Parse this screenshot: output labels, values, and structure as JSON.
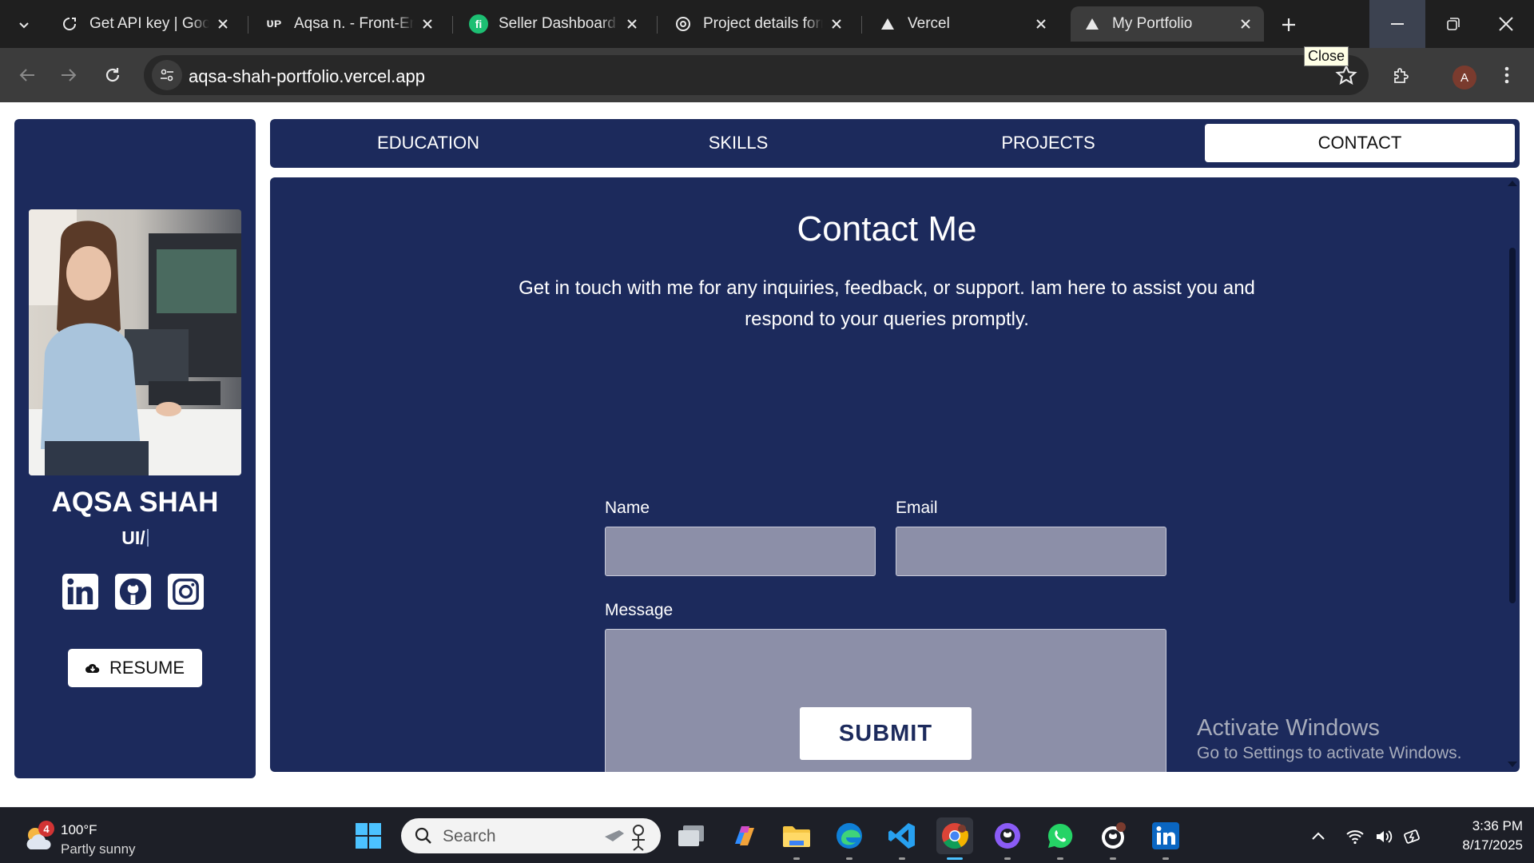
{
  "browser": {
    "tabs": [
      {
        "title": "Get API key | Google AI Studio",
        "icon": "ai-studio-icon"
      },
      {
        "title": "Aqsa n. - Front-End Developer",
        "icon": "upwork-icon"
      },
      {
        "title": "Seller Dashboard",
        "icon": "fiverr-icon"
      },
      {
        "title": "Project details form",
        "icon": "chatgpt-icon"
      },
      {
        "title": "Vercel",
        "icon": "vercel-icon"
      },
      {
        "title": "My Portfolio",
        "icon": "vercel-icon",
        "active": true
      }
    ],
    "url": "aqsa-shah-portfolio.vercel.app",
    "tooltip": "Close",
    "profile_initial": "A"
  },
  "sidebar": {
    "name": "AQSA SHAH",
    "role_typed": "UI/",
    "socials": [
      "linkedin-icon",
      "github-icon",
      "instagram-icon"
    ],
    "resume_label": "RESUME"
  },
  "nav": {
    "tabs": [
      "EDUCATION",
      "SKILLS",
      "PROJECTS",
      "CONTACT"
    ],
    "active": "CONTACT"
  },
  "contact": {
    "title": "Contact Me",
    "description": "Get in touch with me for any inquiries, feedback, or support. Iam here to assist you and respond to your queries promptly.",
    "name_label": "Name",
    "name_value": "",
    "email_label": "Email",
    "email_value": "",
    "message_label": "Message",
    "message_value": "",
    "submit_label": "SUBMIT"
  },
  "watermark": {
    "line1": "Activate Windows",
    "line2": "Go to Settings to activate Windows."
  },
  "taskbar": {
    "weather_temp": "100°F",
    "weather_desc": "Partly sunny",
    "weather_badge": "4",
    "search_placeholder": "Search",
    "time": "3:36 PM",
    "date": "8/17/2025"
  },
  "colors": {
    "panel": "#1c2a5c",
    "field": "#8c8fa8",
    "chrome_dark": "#1f1f1f",
    "chrome_toolbar": "#3c3c3c",
    "taskbar": "#1d1f27"
  }
}
